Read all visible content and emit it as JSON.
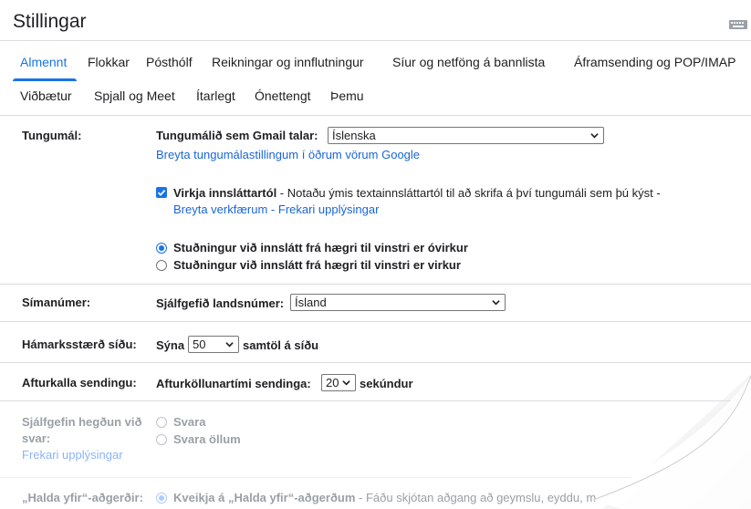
{
  "header": {
    "title": "Stillingar"
  },
  "tabs_row1": [
    {
      "label": "Almennt",
      "active": true
    },
    {
      "label": "Flokkar",
      "active": false
    },
    {
      "label": "Pósthólf",
      "active": false
    },
    {
      "label": "Reikningar og innflutningur",
      "active": false
    },
    {
      "label": "Síur og netföng á bannlista",
      "active": false
    },
    {
      "label": "Áframsending og POP/IMAP",
      "active": false
    }
  ],
  "tabs_row2": [
    {
      "label": "Viðbætur"
    },
    {
      "label": "Spjall og Meet"
    },
    {
      "label": "Ítarlegt"
    },
    {
      "label": "Ónettengt"
    },
    {
      "label": "Þemu"
    }
  ],
  "language": {
    "label": "Tungumál:",
    "gmail_lang_label": "Tungumálið sem Gmail talar:",
    "gmail_lang_value": "Íslenska",
    "change_other_link": "Breyta tungumálastillingum í öðrum vörum Google",
    "input_tools_bold": "Virkja innsláttartól",
    "input_tools_desc": " - Notaðu ýmis textainnsláttartól til að skrifa á því tungumáli sem þú kýst -",
    "edit_tools_link": "Breyta verkfærum",
    "dash": " - ",
    "more_info_link": "Frekari upplýsingar",
    "rtl_off": "Stuðningur við innslátt frá hægri til vinstri er óvirkur",
    "rtl_on": "Stuðningur við innslátt frá hægri til vinstri er virkur"
  },
  "phone": {
    "label": "Símanúmer:",
    "default_country_label": "Sjálfgefið landsnúmer:",
    "default_country_value": "Ísland"
  },
  "page_size": {
    "label": "Hámarksstærð síðu:",
    "show_label": "Sýna",
    "value": "50",
    "suffix": "samtöl á síðu"
  },
  "undo_send": {
    "label": "Afturkalla sendingu:",
    "period_label": "Afturköllunartími sendinga:",
    "value": "20",
    "suffix": "sekúndur"
  },
  "reply_behavior": {
    "label_line1": "Sjálfgefin hegðun við",
    "label_line2": "svar:",
    "more_info_link": "Frekari upplýsingar",
    "option_reply": "Svara",
    "option_reply_all": "Svara öllum"
  },
  "hover_actions": {
    "label": "„Halda yfir“-aðgerðir:",
    "option_bold": "Kveikja á „Halda yfir“-aðgerðum",
    "option_desc": " - Fáðu skjótan aðgang að geymslu, eyddu, m"
  },
  "colors": {
    "accent": "#1a73e8",
    "link": "#1a66d6",
    "divider": "#dadce0"
  },
  "icons": {
    "keyboard": "keyboard-icon",
    "chevron": "chevron-down-icon",
    "checkbox": "check-icon"
  }
}
